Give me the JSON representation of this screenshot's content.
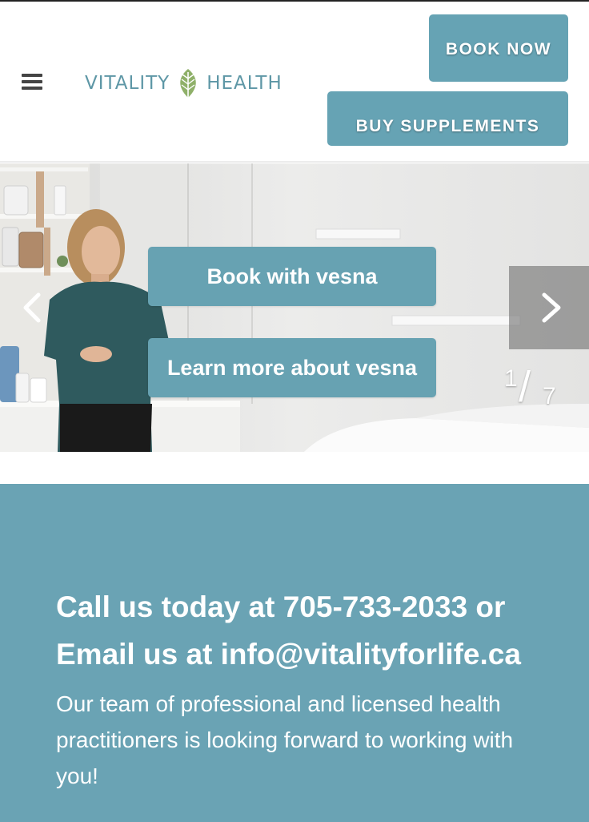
{
  "header": {
    "menu_icon": "hamburger-menu-icon",
    "logo": {
      "word_left": "VITALITY",
      "word_right": "HEALTH",
      "icon": "leaf-icon",
      "leaf_color": "#8fb069"
    },
    "book_now_label": "BOOK NOW",
    "buy_supplements_label": "BUY SUPPLEMENTS"
  },
  "hero": {
    "book_button_label": "Book with vesna",
    "learn_button_label": "Learn more about vesna",
    "prev_icon": "chevron-left-icon",
    "next_icon": "chevron-right-icon",
    "slide_current": "1",
    "slide_total": "7"
  },
  "contact": {
    "heading": "Call us today at 705-733-2033 or Email us at info@vitalityforlife.ca",
    "body": "Our team of professional and licensed health practitioners is looking forward to working with you!"
  },
  "colors": {
    "accent": "#66a3b4",
    "brand_text": "#5e97a6",
    "section_bg": "#6aa3b4"
  }
}
